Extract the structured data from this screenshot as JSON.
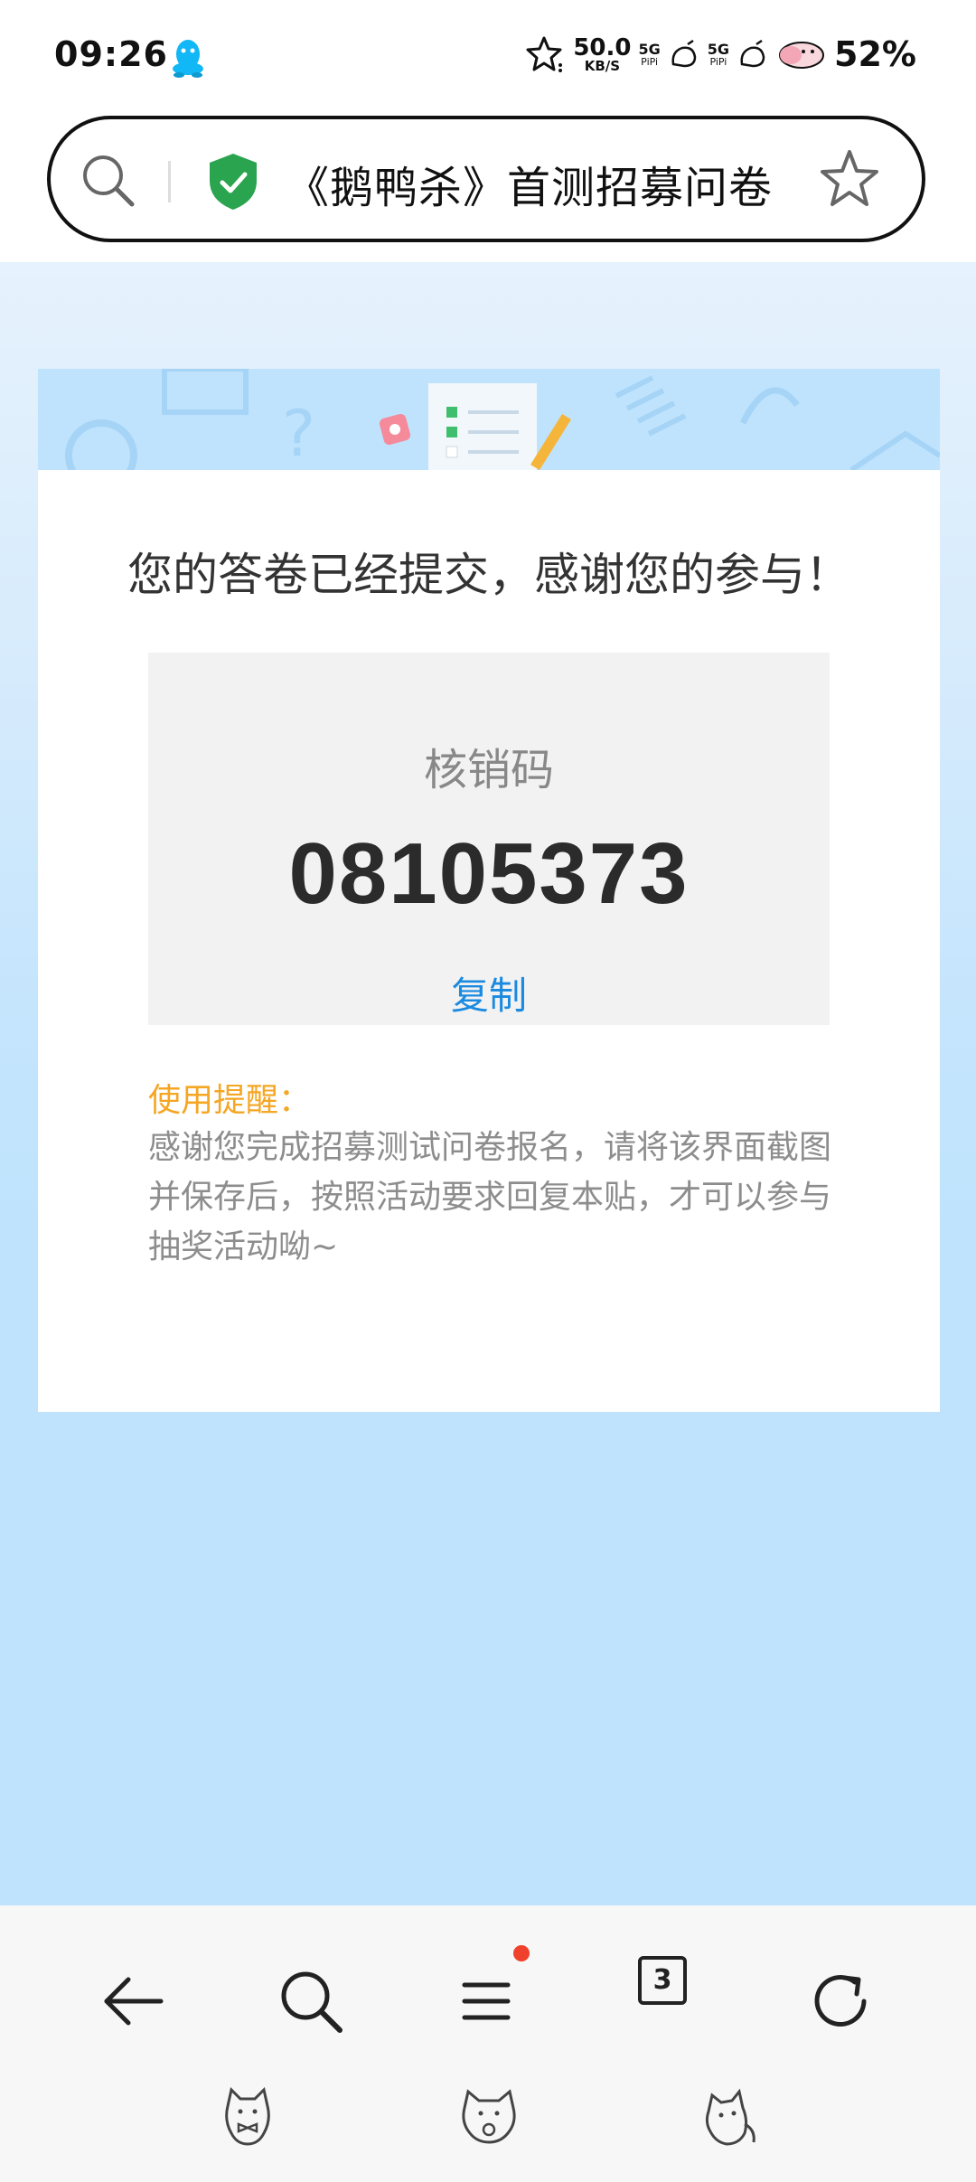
{
  "status_bar": {
    "time": "09:26",
    "net_speed_value": "50.0",
    "net_speed_unit": "KB/S",
    "signal1_label": "5G",
    "signal1_sub": "PiPi",
    "signal2_label": "5G",
    "signal2_sub": "PiPi",
    "battery": "52%"
  },
  "address_bar": {
    "title": "《鹅鸭杀》首测招募问卷"
  },
  "card": {
    "thanks_message": "您的答卷已经提交，感谢您的参与！",
    "code_label": "核销码",
    "code_value": "08105373",
    "copy_label": "复制",
    "tip_title": "使用提醒：",
    "tip_body": "感谢您完成招募测试问卷报名，请将该界面截图并保存后，按照活动要求回复本贴，才可以参与抽奖活动呦~"
  },
  "bottom_nav": {
    "tab_count": "3"
  },
  "colors": {
    "accent_blue": "#1a8ae0",
    "tip_orange": "#f5a623",
    "page_blue": "#bfe3fd",
    "shield_green": "#2aa44f",
    "notification_red": "#f0412c"
  }
}
